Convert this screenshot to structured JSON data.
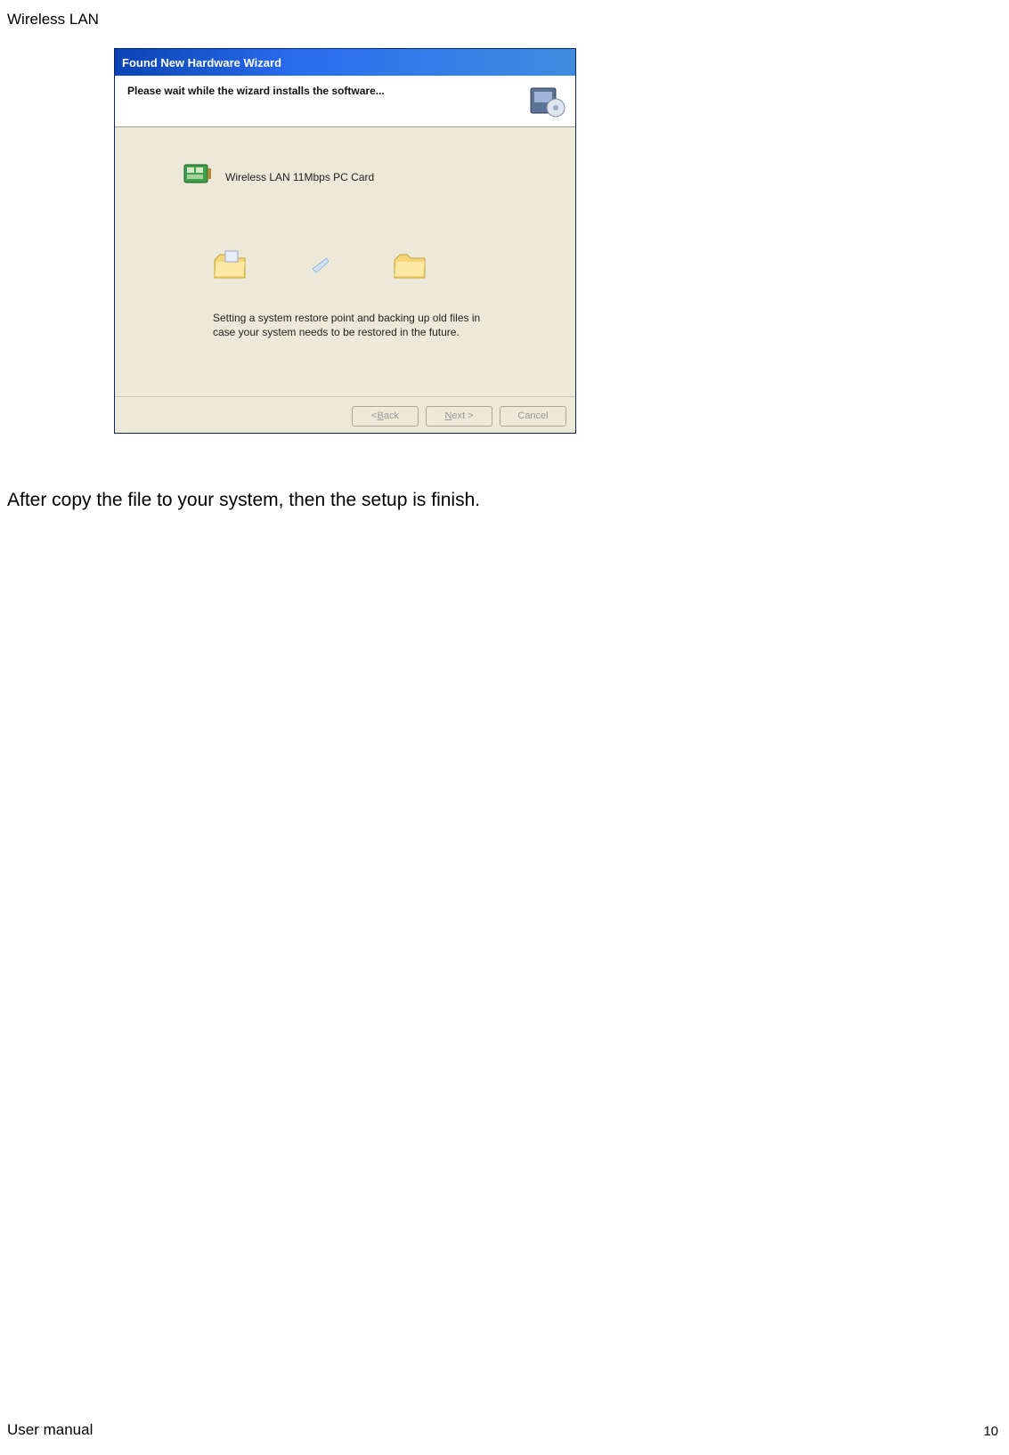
{
  "header": {
    "title": "Wireless LAN"
  },
  "footer": {
    "left": "User manual",
    "page": "10"
  },
  "dialog": {
    "title": "Found New Hardware Wizard",
    "banner_text": "Please wait while the wizard installs the software...",
    "device_name": "Wireless LAN 11Mbps PC Card",
    "status_text": "Setting a system restore point and backing up old files in case your system needs to be restored in the future.",
    "buttons": {
      "back_prefix": "< ",
      "back_ul": "B",
      "back_rest": "ack",
      "next_ul": "N",
      "next_rest": "ext >",
      "cancel": "Cancel"
    }
  },
  "caption": "After copy the file to your system, then the setup is finish."
}
